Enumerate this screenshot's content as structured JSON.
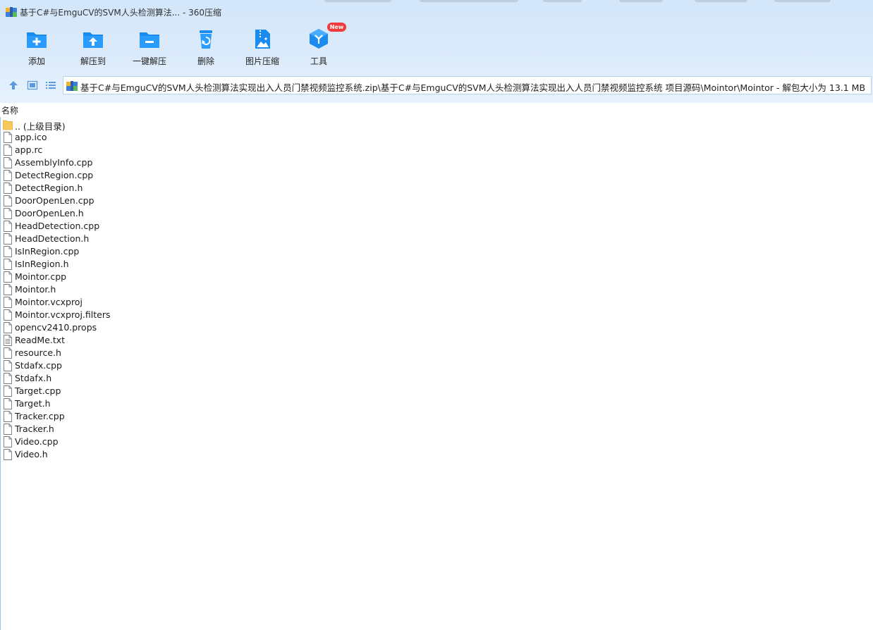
{
  "window": {
    "title": "基于C#与EmguCV的SVM人头检测算法... - 360压缩"
  },
  "toolbar": {
    "buttons": [
      {
        "label": "添加",
        "icon": "add-folder-icon"
      },
      {
        "label": "解压到",
        "icon": "extract-to-icon"
      },
      {
        "label": "一键解压",
        "icon": "one-click-extract-icon"
      },
      {
        "label": "删除",
        "icon": "delete-icon"
      },
      {
        "label": "图片压缩",
        "icon": "image-compress-icon"
      },
      {
        "label": "工具",
        "icon": "tools-icon",
        "badge": "New"
      }
    ]
  },
  "nav": {
    "buttons": [
      "up-arrow-icon",
      "thumbnail-view-icon",
      "list-view-icon"
    ]
  },
  "address": {
    "path": "基于C#与EmguCV的SVM人头检测算法实现出入人员门禁视频监控系统.zip\\基于C#与EmguCV的SVM人头检测算法实现出入人员门禁视频监控系统 项目源码\\Mointor\\Mointor - 解包大小为 13.1 MB"
  },
  "columns": {
    "name": "名称"
  },
  "files": [
    {
      "name": ".. (上级目录)",
      "type": "folder"
    },
    {
      "name": "app.ico",
      "type": "file"
    },
    {
      "name": "app.rc",
      "type": "file"
    },
    {
      "name": "AssemblyInfo.cpp",
      "type": "file"
    },
    {
      "name": "DetectRegion.cpp",
      "type": "file"
    },
    {
      "name": "DetectRegion.h",
      "type": "file"
    },
    {
      "name": "DoorOpenLen.cpp",
      "type": "file"
    },
    {
      "name": "DoorOpenLen.h",
      "type": "file"
    },
    {
      "name": "HeadDetection.cpp",
      "type": "file"
    },
    {
      "name": "HeadDetection.h",
      "type": "file"
    },
    {
      "name": "IsInRegion.cpp",
      "type": "file"
    },
    {
      "name": "IsInRegion.h",
      "type": "file"
    },
    {
      "name": "Mointor.cpp",
      "type": "file"
    },
    {
      "name": "Mointor.h",
      "type": "file"
    },
    {
      "name": "Mointor.vcxproj",
      "type": "file"
    },
    {
      "name": "Mointor.vcxproj.filters",
      "type": "file"
    },
    {
      "name": "opencv2410.props",
      "type": "file"
    },
    {
      "name": "ReadMe.txt",
      "type": "text"
    },
    {
      "name": "resource.h",
      "type": "file"
    },
    {
      "name": "Stdafx.cpp",
      "type": "file"
    },
    {
      "name": "Stdafx.h",
      "type": "file"
    },
    {
      "name": "Target.cpp",
      "type": "file"
    },
    {
      "name": "Target.h",
      "type": "file"
    },
    {
      "name": "Tracker.cpp",
      "type": "file"
    },
    {
      "name": "Tracker.h",
      "type": "file"
    },
    {
      "name": "Video.cpp",
      "type": "file"
    },
    {
      "name": "Video.h",
      "type": "file"
    }
  ],
  "colors": {
    "accent": "#1a8cf0",
    "toolbar_bg": "#d6e8fb",
    "badge": "#f23a3a",
    "folder": "#f7c95c"
  }
}
